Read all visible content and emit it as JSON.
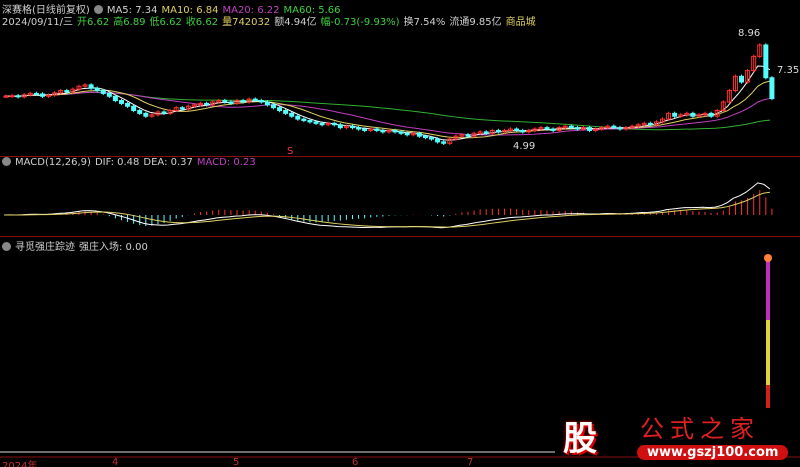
{
  "header": {
    "stock_name": "深赛格(日线前复权)",
    "ma5": "MA5: 7.34",
    "ma10": "MA10: 6.84",
    "ma20": "MA20: 6.22",
    "ma60": "MA60: 5.66",
    "date": "2024/09/11/三",
    "open": "开6.62",
    "high": "高6.89",
    "low": "低6.62",
    "close": "收6.62",
    "volume": "量742032",
    "amount": "额4.94亿",
    "change": "幅-0.73(-9.93%)",
    "turnover": "换7.54%",
    "float": "流通9.85亿",
    "sector": "商品城"
  },
  "price_chart": {
    "high_label": "8.96",
    "last_label": "7.35",
    "low_label": "4.99",
    "marker": "S",
    "closes": [
      6.7,
      6.72,
      6.68,
      6.75,
      6.8,
      6.78,
      6.7,
      6.74,
      6.82,
      6.9,
      6.85,
      6.95,
      7.05,
      7.1,
      6.98,
      6.9,
      6.8,
      6.7,
      6.55,
      6.45,
      6.35,
      6.2,
      6.1,
      6.0,
      6.05,
      6.15,
      6.1,
      6.2,
      6.3,
      6.25,
      6.35,
      6.4,
      6.45,
      6.4,
      6.5,
      6.55,
      6.5,
      6.45,
      6.55,
      6.5,
      6.6,
      6.55,
      6.5,
      6.4,
      6.3,
      6.2,
      6.1,
      6.0,
      5.9,
      5.85,
      5.8,
      5.75,
      5.7,
      5.75,
      5.7,
      5.6,
      5.65,
      5.6,
      5.55,
      5.5,
      5.55,
      5.5,
      5.45,
      5.5,
      5.45,
      5.4,
      5.35,
      5.4,
      5.3,
      5.25,
      5.2,
      5.1,
      5.05,
      5.2,
      5.3,
      5.35,
      5.3,
      5.4,
      5.45,
      5.4,
      5.5,
      5.45,
      5.5,
      5.55,
      5.5,
      5.45,
      5.5,
      5.55,
      5.6,
      5.55,
      5.5,
      5.6,
      5.65,
      5.6,
      5.55,
      5.6,
      5.5,
      5.55,
      5.6,
      5.65,
      5.6,
      5.55,
      5.6,
      5.65,
      5.7,
      5.75,
      5.7,
      5.8,
      5.9,
      6.1,
      6.0,
      6.05,
      6.1,
      6.0,
      6.05,
      6.1,
      6.0,
      6.2,
      6.5,
      6.9,
      7.4,
      7.2,
      7.6,
      8.1,
      8.5,
      7.35,
      6.62
    ]
  },
  "macd": {
    "title": "MACD(12,26,9)",
    "dif": "DIF: 0.48",
    "dea": "DEA: 0.37",
    "macd": "MACD: 0.23"
  },
  "indicator": {
    "title": "寻觅强庄踪迹",
    "value": "强庄入场: 0.00",
    "level": 1.0
  },
  "axis": {
    "labels": [
      "2024年",
      "4",
      "5",
      "6",
      "7"
    ]
  },
  "watermark": {
    "brand": "股",
    "text": "公式之家",
    "url": "www.gszj100.com"
  },
  "colors": {
    "up": "#ff3030",
    "down": "#54ffff",
    "ma5": "#ffffff",
    "ma10": "#e0d060",
    "ma20": "#c040c0",
    "ma60": "#30b030"
  }
}
